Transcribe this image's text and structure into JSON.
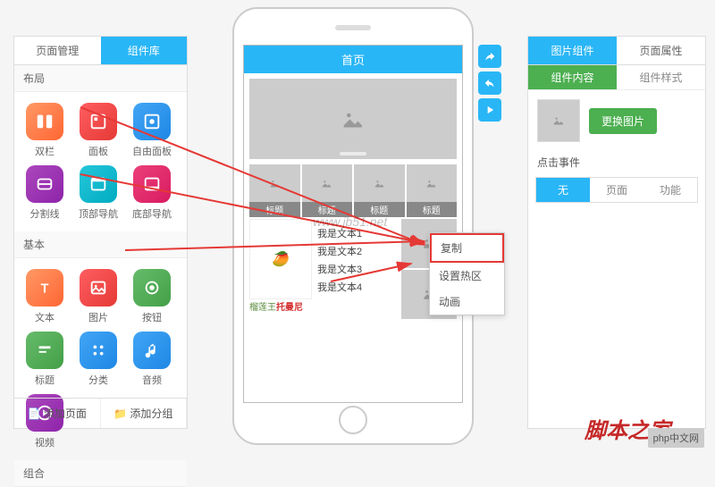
{
  "left": {
    "tabs": [
      "页面管理",
      "组件库"
    ],
    "sections": {
      "layout": "布局",
      "basic": "基本",
      "combo": "组合"
    },
    "widgets": {
      "layout": [
        {
          "name": "双栏",
          "icon": "split",
          "color": "i-orange"
        },
        {
          "name": "面板",
          "icon": "panel",
          "color": "i-red"
        },
        {
          "name": "自由面板",
          "icon": "free",
          "color": "i-blue"
        },
        {
          "name": "分割线",
          "icon": "divider",
          "color": "i-purple"
        },
        {
          "name": "顶部导航",
          "icon": "topnav",
          "color": "i-cyan"
        },
        {
          "name": "底部导航",
          "icon": "botnav",
          "color": "i-pink"
        }
      ],
      "basic": [
        {
          "name": "文本",
          "icon": "text",
          "color": "i-orange"
        },
        {
          "name": "图片",
          "icon": "image",
          "color": "i-red"
        },
        {
          "name": "按钮",
          "icon": "button",
          "color": "i-green"
        },
        {
          "name": "标题",
          "icon": "title",
          "color": "i-green"
        },
        {
          "name": "分类",
          "icon": "category",
          "color": "i-blue"
        },
        {
          "name": "音频",
          "icon": "audio",
          "color": "i-blue"
        },
        {
          "name": "视频",
          "icon": "video",
          "color": "i-purple"
        }
      ]
    },
    "bottom": [
      "添加页面",
      "添加分组"
    ]
  },
  "phone": {
    "title": "首页",
    "row_caption": "标题",
    "texts": [
      "我是文本1",
      "我是文本2",
      "我是文本3",
      "我是文本4"
    ],
    "product_g": "榴莲王",
    "product_r": "托曼尼"
  },
  "context_menu": [
    "复制",
    "设置热区",
    "动画"
  ],
  "right": {
    "tabs": [
      "图片组件",
      "页面属性"
    ],
    "subtabs": [
      "组件内容",
      "组件样式"
    ],
    "change_img": "更换图片",
    "event_label": "点击事件",
    "event_tabs": [
      "无",
      "页面",
      "功能"
    ]
  },
  "watermark": "www.jb51.net",
  "footer_logo": "脚本之家",
  "footer_tag": "php中文网"
}
